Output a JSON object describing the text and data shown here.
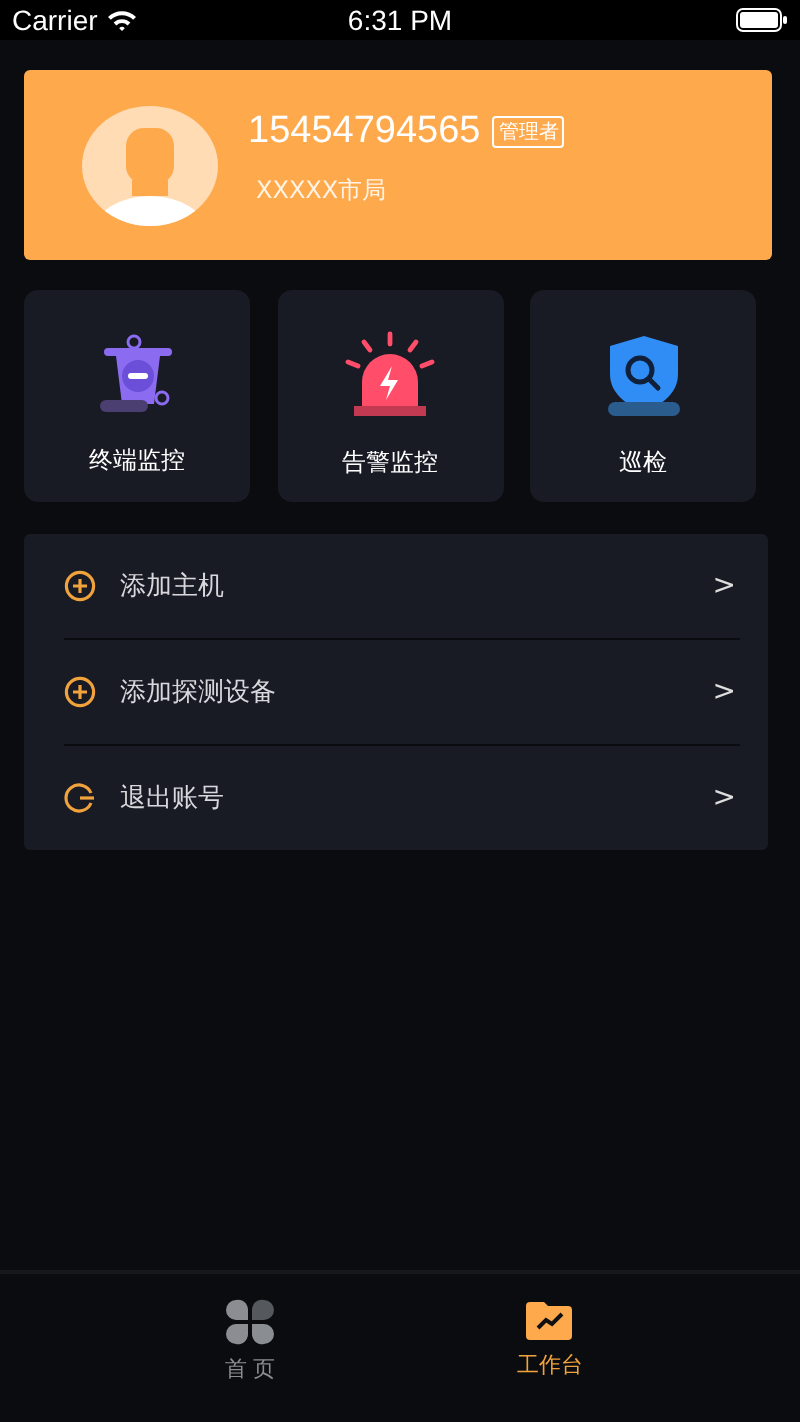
{
  "status_bar": {
    "carrier": "Carrier",
    "time": "6:31 PM"
  },
  "profile": {
    "phone": "15454794565",
    "role_badge": "管理者",
    "organization": "XXXXX市局"
  },
  "tiles": [
    {
      "kind": "terminal",
      "label": "终端监控"
    },
    {
      "kind": "alarm",
      "label": "告警监控"
    },
    {
      "kind": "inspect",
      "label": "巡检"
    }
  ],
  "menu": [
    {
      "kind": "add",
      "label": "添加主机",
      "chevron": ">"
    },
    {
      "kind": "add",
      "label": "添加探测设备",
      "chevron": ">"
    },
    {
      "kind": "logout",
      "label": "退出账号",
      "chevron": ">"
    }
  ],
  "tab_bar": [
    {
      "kind": "home",
      "label": "首 页",
      "selected": false
    },
    {
      "kind": "workbench",
      "label": "工作台",
      "selected": true
    }
  ]
}
